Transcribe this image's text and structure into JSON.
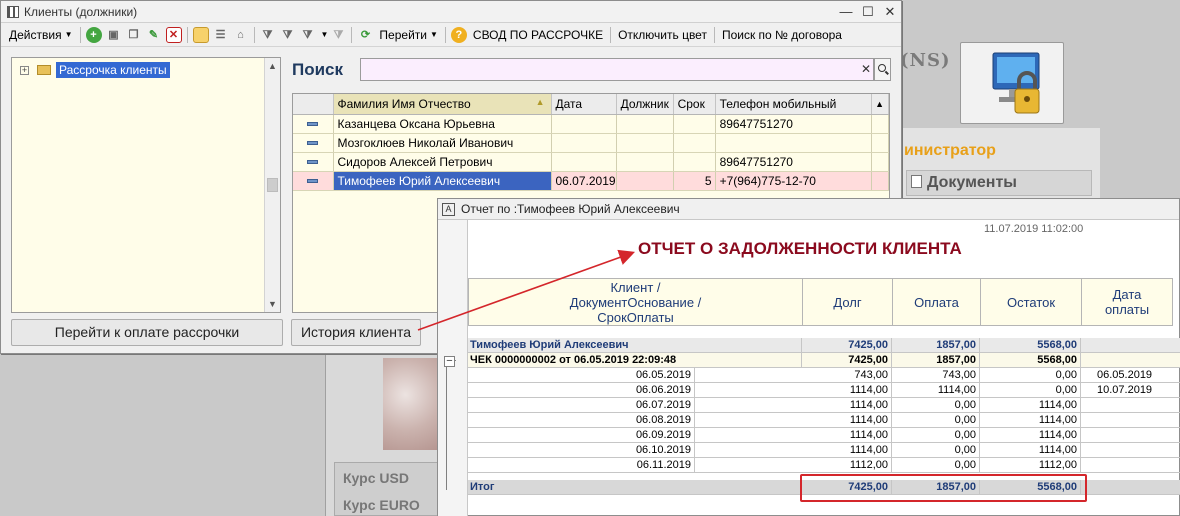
{
  "background": {
    "ns_text": "(NS)",
    "admin_text": "инистратор",
    "docs_text": "Документы",
    "rate_usd": "Курс USD",
    "rate_euro": "Курс EURO"
  },
  "clients_window": {
    "title": "Клиенты (должники)",
    "toolbar": {
      "actions": "Действия",
      "goto": "Перейти",
      "summary": "СВОД ПО РАССРОЧКЕ",
      "disable_color": "Отключить цвет",
      "search_contract": "Поиск по № договора"
    },
    "tree": {
      "item_label": "Рассрочка клиенты"
    },
    "search": {
      "label": "Поиск",
      "value": ""
    },
    "grid": {
      "columns": [
        "Фамилия Имя Отчество",
        "Дата",
        "Должник",
        "Срок",
        "Телефон мобильный"
      ],
      "rows": [
        {
          "name": "Казанцева Оксана Юрьевна",
          "date": "",
          "debtor": "",
          "term": "",
          "phone": "89647751270"
        },
        {
          "name": "Мозгоклюев Николай Иванович",
          "date": "",
          "debtor": "",
          "term": "",
          "phone": ""
        },
        {
          "name": "Сидоров Алексей Петрович",
          "date": "",
          "debtor": "",
          "term": "",
          "phone": "89647751270"
        },
        {
          "name": "Тимофеев Юрий Алексеевич",
          "date": "06.07.2019",
          "debtor": "",
          "term": "5",
          "phone": "+7(964)775-12-70"
        }
      ]
    },
    "buttons": {
      "pay": "Перейти к оплате рассрочки",
      "history": "История клиента"
    }
  },
  "report_window": {
    "title": "Отчет по :Тимофеев Юрий Алексеевич",
    "timestamp": "11.07.2019 11:02:00",
    "heading": "ОТЧЕТ О ЗАДОЛЖЕННОСТИ КЛИЕНТА",
    "headers": {
      "client": "Клиент /\nДокументОснование /\nСрокОплаты",
      "debt": "Долг",
      "paid": "Оплата",
      "remainder": "Остаток",
      "pay_date": "Дата\nоплаты"
    },
    "client_row": {
      "name": "Тимофеев Юрий Алексеевич",
      "debt": "7425,00",
      "paid": "1857,00",
      "remainder": "5568,00"
    },
    "check_row": {
      "name": "ЧЕК 0000000002 от 06.05.2019 22:09:48",
      "debt": "7425,00",
      "paid": "1857,00",
      "remainder": "5568,00"
    },
    "schedule": [
      {
        "due": "06.05.2019",
        "debt": "743,00",
        "paid": "743,00",
        "remainder": "0,00",
        "pay_date": "06.05.2019"
      },
      {
        "due": "06.06.2019",
        "debt": "1114,00",
        "paid": "1114,00",
        "remainder": "0,00",
        "pay_date": "10.07.2019"
      },
      {
        "due": "06.07.2019",
        "debt": "1114,00",
        "paid": "0,00",
        "remainder": "1114,00",
        "pay_date": ""
      },
      {
        "due": "06.08.2019",
        "debt": "1114,00",
        "paid": "0,00",
        "remainder": "1114,00",
        "pay_date": ""
      },
      {
        "due": "06.09.2019",
        "debt": "1114,00",
        "paid": "0,00",
        "remainder": "1114,00",
        "pay_date": ""
      },
      {
        "due": "06.10.2019",
        "debt": "1114,00",
        "paid": "0,00",
        "remainder": "1114,00",
        "pay_date": ""
      },
      {
        "due": "06.11.2019",
        "debt": "1112,00",
        "paid": "0,00",
        "remainder": "1112,00",
        "pay_date": ""
      }
    ],
    "total_row": {
      "label": "Итог",
      "debt": "7425,00",
      "paid": "1857,00",
      "remainder": "5568,00"
    }
  },
  "colors": {
    "heading_red": "#8b0a1e",
    "selection_blue": "#3b64c0",
    "annotation_red": "#d4262b"
  }
}
